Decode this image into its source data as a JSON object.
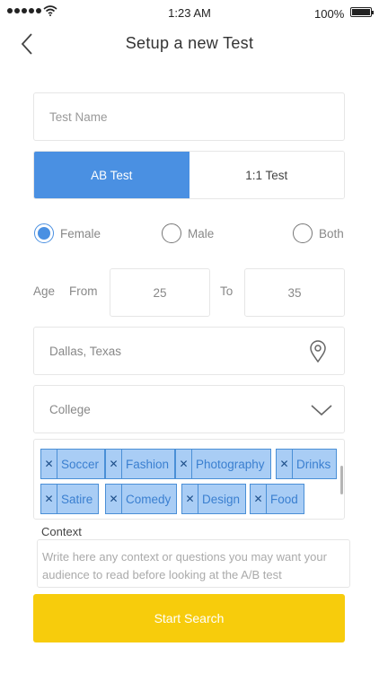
{
  "status_bar": {
    "time": "1:23 AM",
    "battery": "100%"
  },
  "nav": {
    "title": "Setup a new Test"
  },
  "form": {
    "test_name_placeholder": "Test Name",
    "segments": [
      {
        "label": "AB Test",
        "selected": true
      },
      {
        "label": "1:1 Test",
        "selected": false
      }
    ],
    "gender": [
      {
        "label": "Female",
        "selected": true
      },
      {
        "label": "Male",
        "selected": false
      },
      {
        "label": "Both",
        "selected": false
      }
    ],
    "age": {
      "label": "Age",
      "from_label": "From",
      "from_value": "25",
      "to_label": "To",
      "to_value": "35"
    },
    "location": "Dallas, Texas",
    "education": "College",
    "tags": [
      "Soccer",
      "Fashion",
      "Photography",
      "Drinks",
      "Satire",
      "Comedy",
      "Design",
      "Food"
    ],
    "context_label": "Context",
    "context_placeholder": "Write here any context or questions you may want your audience to read before looking at the A/B test",
    "start_button": "Start Search"
  },
  "colors": {
    "accent": "#4a90e2",
    "start": "#f7cc0c",
    "tag_fill": "#a9cdf5"
  },
  "icons": [
    "back-chevron-icon",
    "wifi-icon",
    "location-pin-icon",
    "chevron-down-icon",
    "remove-tag-icon"
  ]
}
